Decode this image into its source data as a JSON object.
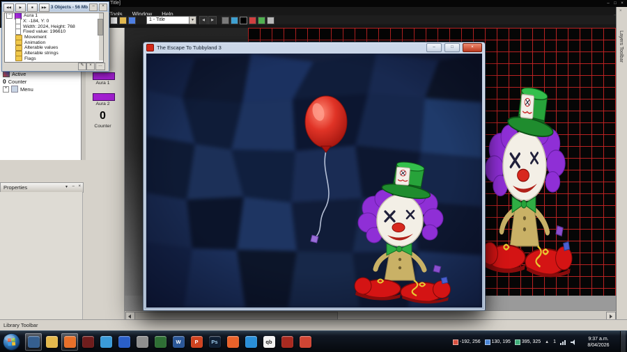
{
  "app": {
    "title_fragment": "Title]",
    "menu": [
      "Tools",
      "Window",
      "Help"
    ],
    "frame_combo": "1 - Title"
  },
  "glyphs": {
    "min": "–",
    "max": "□",
    "close": "×",
    "down": "▾",
    "left": "◀",
    "right": "▶",
    "up": "▲",
    "plus": "+",
    "minus": "−",
    "dots": "…",
    "edit": "✎",
    "check": "✓"
  },
  "debugger": {
    "title": "3 Objects - 56 Mb",
    "media_buttons": [
      "◀◀",
      "▶",
      "■",
      "▶▶"
    ],
    "footer_buttons": [
      "✎",
      "×",
      "…"
    ],
    "tree": {
      "root": "Aura 1",
      "values": [
        "X: -184, Y: 0",
        "Width: 2024, Height: 768",
        "Fixed value: 196610"
      ],
      "folders": [
        "Movement",
        "Animation",
        "Alterable values",
        "Alterable strings",
        "Flags"
      ]
    }
  },
  "object_tree": {
    "items": [
      {
        "label": "Active"
      },
      {
        "prefix": "0",
        "label": "Counter"
      },
      {
        "label": "Menu"
      }
    ]
  },
  "shelf": {
    "swatch_color": "#a21fd0",
    "items": [
      {
        "label": "Aura 1"
      },
      {
        "label": "Aura 2"
      }
    ],
    "counter": {
      "value": "0",
      "label": "Counter"
    }
  },
  "properties": {
    "title": "Properties"
  },
  "layers_toolbar": "Layers Toolbar",
  "library_toolbar": "Library Toolbar",
  "preview": {
    "title": "The Escape To Tubbyland 3"
  },
  "taskbar": {
    "icons": [
      {
        "name": "app-window",
        "color": "#355f8f",
        "fg": "#ffffff",
        "glyph": ""
      },
      {
        "name": "explorer",
        "color": "#e3b84d",
        "fg": "#ffffff",
        "glyph": ""
      },
      {
        "name": "firefox",
        "color": "#e8702a",
        "fg": "#ffffff",
        "glyph": ""
      },
      {
        "name": "media-app",
        "color": "#6f1d1d",
        "fg": "#ffffff",
        "glyph": ""
      },
      {
        "name": "messenger",
        "color": "#3a9ad8",
        "fg": "#ffffff",
        "glyph": ""
      },
      {
        "name": "browser",
        "color": "#2a5fc8",
        "fg": "#ffffff",
        "glyph": ""
      },
      {
        "name": "utility",
        "color": "#8f8f8f",
        "fg": "#ffffff",
        "glyph": ""
      },
      {
        "name": "game-app",
        "color": "#2f6f35",
        "fg": "#ffffff",
        "glyph": ""
      },
      {
        "name": "word",
        "color": "#2b5797",
        "fg": "#ffffff",
        "glyph": "W"
      },
      {
        "name": "powerpoint",
        "color": "#cf4320",
        "fg": "#ffffff",
        "glyph": "P"
      },
      {
        "name": "photoshop",
        "color": "#101f33",
        "fg": "#9ac8e8",
        "glyph": "Ps"
      },
      {
        "name": "firefox-alt",
        "color": "#e8622a",
        "fg": "#ffffff",
        "glyph": ""
      },
      {
        "name": "media-player",
        "color": "#2a8fd8",
        "fg": "#ffffff",
        "glyph": ""
      },
      {
        "name": "qbasic",
        "color": "#f2f2f2",
        "fg": "#222222",
        "glyph": "qb"
      },
      {
        "name": "fusion",
        "color": "#a82a20",
        "fg": "#ffffff",
        "glyph": ""
      },
      {
        "name": "installer",
        "color": "#d04534",
        "fg": "#ffffff",
        "glyph": ""
      }
    ],
    "tray": {
      "coords": [
        {
          "label": "-192, 256",
          "color": "#d85040"
        },
        {
          "label": "130, 195",
          "color": "#4a86d8"
        },
        {
          "label": "395, 325",
          "color": "#3fae7a"
        }
      ],
      "count": "1",
      "time": "9:37 a.m.",
      "date": "8/04/2026"
    }
  }
}
